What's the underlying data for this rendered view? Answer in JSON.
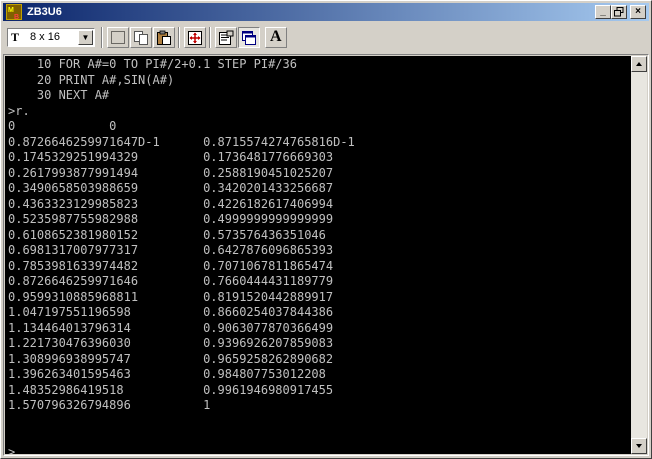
{
  "window": {
    "title": "ZB3U6"
  },
  "toolbar": {
    "font_size_value": "8 x 16",
    "font_button_label": "A"
  },
  "console": {
    "lines": [
      "    10 FOR A#=0 TO PI#/2+0.1 STEP PI#/36",
      "    20 PRINT A#,SIN(A#)",
      "    30 NEXT A#",
      ">r.",
      "0             0",
      "0.8726646259971647D-1      0.8715574274765816D-1",
      "0.1745329251994329         0.1736481776669303",
      "0.2617993877991494         0.2588190451025207",
      "0.3490658503988659         0.3420201433256687",
      "0.4363323129985823         0.4226182617406994",
      "0.5235987755982988         0.4999999999999999",
      "0.6108652381980152         0.573576436351046",
      "0.6981317007977317         0.6427876096865393",
      "0.7853981633974482         0.7071067811865474",
      "0.8726646259971646         0.7660444431189779",
      "0.9599310885968811         0.8191520442889917",
      "1.047197551196598          0.8660254037844386",
      "1.134464013796314          0.9063077870366499",
      "1.221730476396030          0.9396926207859083",
      "1.308996938995747          0.9659258262890682",
      "1.396263401595463          0.984807753012208",
      "1.48352986419518           0.9961946980917455",
      "1.570796326794896          1",
      "",
      "",
      ">"
    ]
  },
  "icons": {
    "app": "basic-app-icon",
    "select": "select-rectangle-icon",
    "copy": "copy-icon",
    "paste": "paste-icon",
    "fullscreen": "fullscreen-icon",
    "properties": "properties-icon",
    "window_mode": "window-mode-icon",
    "font": "font-icon"
  }
}
